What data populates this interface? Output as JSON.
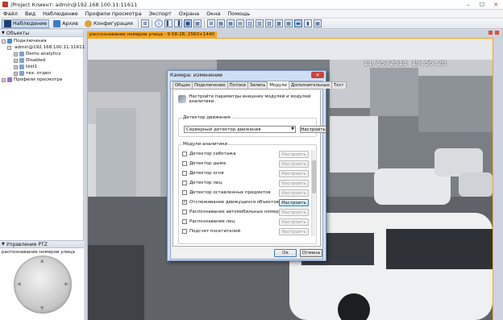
{
  "window": {
    "title": "Клиент: admin@192.168.100.11:11611",
    "app_prefix": "|Project"
  },
  "menu": [
    "Файл",
    "Вид",
    "Наблюдение",
    "Профили просмотра",
    "Экспорт",
    "Охрана",
    "Окна",
    "Помощь"
  ],
  "toolbar": {
    "observe_label": "Наблюдение",
    "archive_label": "Архив",
    "config_label": "Конфигурация"
  },
  "objects_panel": {
    "title": "Объекты",
    "tree": {
      "connections": "Подключения",
      "server": "admin@192.168.100.11:11611",
      "items": [
        "Demo analytics",
        "Disabled",
        "test1",
        "тех. отдел"
      ],
      "profiles": "Профили просмотра"
    }
  },
  "ptz_panel": {
    "title": "Управление PTZ",
    "camera": "распознавание номеров улица"
  },
  "video": {
    "label": "распознавание номеров улица - 9:58:28; 2560×1440",
    "osd": "11/15/2018 19:58:28"
  },
  "dialog": {
    "title": "Камера: изменение",
    "tabs": [
      "Общие",
      "Подключение",
      "Потоки",
      "Запись",
      "Модули",
      "Дополнительные",
      "Тест"
    ],
    "selected_tab": 4,
    "hint": "Настройте параметры внешних модулей и модулей аналитики.",
    "motion_group": "Детектор движения",
    "motion_value": "Серверный детектор движения",
    "configure_label": "Настроить",
    "analytics_group": "Модули аналитики",
    "modules": [
      {
        "label": "Детектор саботажа",
        "checked": false,
        "button": "Настроить"
      },
      {
        "label": "Детектор дыма",
        "checked": false,
        "button": "Настроить"
      },
      {
        "label": "Детектор огня",
        "checked": false,
        "button": "Настроить"
      },
      {
        "label": "Детектор лиц",
        "checked": false,
        "button": "Настроить"
      },
      {
        "label": "Детектор оставленных предметов",
        "checked": false,
        "button": "Настроить"
      },
      {
        "label": "Отслеживание движущихся объектов",
        "checked": true,
        "button": "Настроить"
      },
      {
        "label": "Распознавание автомобильных номеров",
        "checked": false,
        "button": "Настроить"
      },
      {
        "label": "Распознавание лиц",
        "checked": false,
        "button": "Настроить"
      },
      {
        "label": "Подсчет посетителей",
        "checked": false,
        "button": "Настроить"
      }
    ],
    "ok_label": "Ок",
    "cancel_label": "Отмена"
  },
  "colors": {
    "accent_orange": "#f5a623",
    "dialog_frame": "#cfe0f5",
    "close_red": "#c9463d"
  }
}
